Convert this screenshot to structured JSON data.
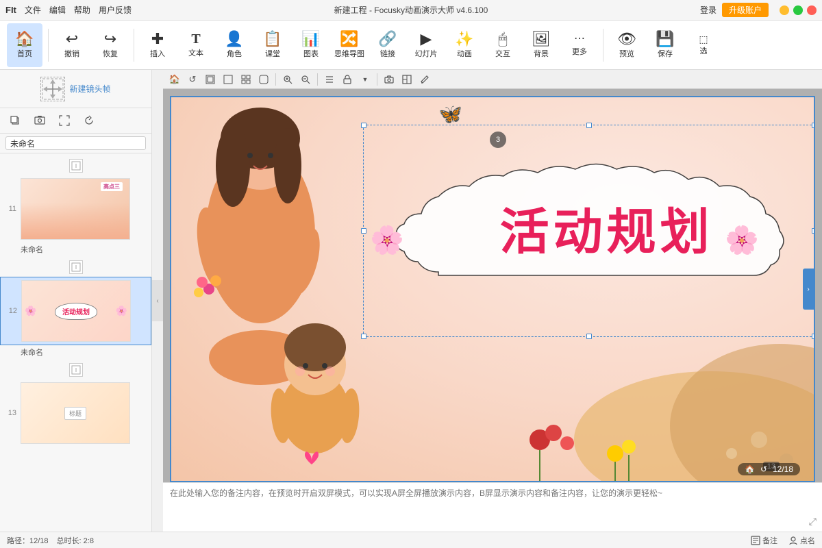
{
  "titlebar": {
    "logo": "FIt",
    "menu": [
      "文件",
      "编辑",
      "帮助",
      "用户反馈"
    ],
    "title": "新建工程 - Focusky动画演示大师 v4.6.100",
    "login": "登录",
    "upgrade": "升级账户",
    "win_min": "−",
    "win_max": "□",
    "win_close": "✕"
  },
  "toolbar": {
    "items": [
      {
        "id": "home",
        "icon": "🏠",
        "label": "首页"
      },
      {
        "id": "undo",
        "icon": "↩",
        "label": "撤销"
      },
      {
        "id": "redo",
        "icon": "↪",
        "label": "恢复"
      },
      {
        "id": "insert",
        "icon": "＋",
        "label": "插入"
      },
      {
        "id": "text",
        "icon": "T",
        "label": "文本"
      },
      {
        "id": "role",
        "icon": "👤",
        "label": "角色"
      },
      {
        "id": "class",
        "icon": "📋",
        "label": "课堂"
      },
      {
        "id": "chart",
        "icon": "📊",
        "label": "图表"
      },
      {
        "id": "mindmap",
        "icon": "🔀",
        "label": "思维导图"
      },
      {
        "id": "link",
        "icon": "🔗",
        "label": "链接"
      },
      {
        "id": "slide",
        "icon": "▶",
        "label": "幻灯片"
      },
      {
        "id": "animation",
        "icon": "✨",
        "label": "动画"
      },
      {
        "id": "interact",
        "icon": "🖱",
        "label": "交互"
      },
      {
        "id": "bg",
        "icon": "🖼",
        "label": "背景"
      },
      {
        "id": "more",
        "icon": "⋯",
        "label": "更多"
      },
      {
        "id": "preview",
        "icon": "👁",
        "label": "预览"
      },
      {
        "id": "save",
        "icon": "💾",
        "label": "保存"
      },
      {
        "id": "select",
        "icon": "⬚",
        "label": "选"
      }
    ]
  },
  "left_panel": {
    "new_frame_label": "新建镜头帧",
    "frame_name": "未命名",
    "slides": [
      {
        "num": "11",
        "name": "未命名",
        "selected": false
      },
      {
        "num": "12",
        "name": "未命名",
        "selected": true
      },
      {
        "num": "13",
        "name": "",
        "selected": false
      }
    ]
  },
  "canvas": {
    "slide_title": "活动规划",
    "slide_num": "12/18"
  },
  "notes": {
    "placeholder": "在此处输入您的备注内容，在预览时开启双屏模式，可以实现A屏全屏播放演示内容，B屏显示演示内容和备注内容，让您的演示更轻松~"
  },
  "statusbar": {
    "path": "路径：12/18",
    "duration": "总时长: 2:8",
    "notes_btn": "备注",
    "points_btn": "点名"
  },
  "canvas_toolbar": {
    "icons": [
      "🏠",
      "↺",
      "◻",
      "◻",
      "◻",
      "◻",
      "◻",
      "🔍",
      "🔍",
      "|",
      "☰",
      "◻",
      "◻",
      "📷",
      "☐",
      "✏"
    ]
  }
}
